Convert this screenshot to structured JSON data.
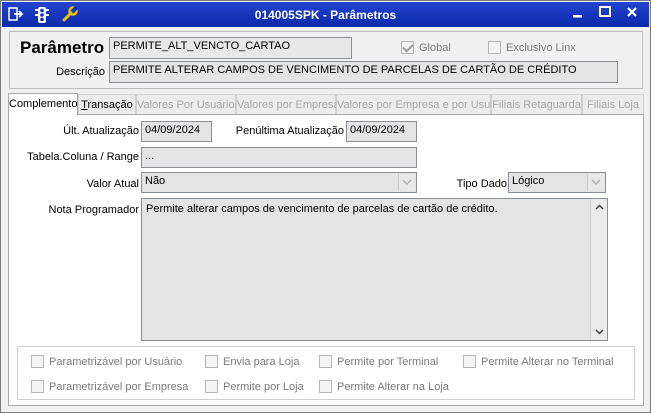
{
  "window": {
    "title": "014005SPK - Parâmetros"
  },
  "header": {
    "param_label": "Parâmetro",
    "param_value": "PERMITE_ALT_VENCTO_CARTAO",
    "desc_label": "Descrição",
    "desc_value": "PERMITE ALTERAR CAMPOS DE VENCIMENTO DE PARCELAS DE CARTÃO DE CRÉDITO",
    "global_label": "Global",
    "global_checked": true,
    "exclusivo_label": "Exclusivo Linx",
    "exclusivo_checked": false
  },
  "tabs": [
    {
      "label": "Complemento",
      "state": "active"
    },
    {
      "label": "Transação",
      "state": "enabled"
    },
    {
      "label": "Valores Por Usuários",
      "state": "disabled"
    },
    {
      "label": "Valores por Empresa",
      "state": "disabled"
    },
    {
      "label": "Valores por Empresa e por Usuário",
      "state": "disabled"
    },
    {
      "label": "Filiais Retaguarda",
      "state": "disabled"
    },
    {
      "label": "Filiais Loja",
      "state": "disabled"
    }
  ],
  "form": {
    "ult_atualizacao_label": "Últ. Atualização",
    "ult_atualizacao_value": "04/09/2024",
    "penultima_label": "Penúltima Atualização",
    "penultima_value": "04/09/2024",
    "tabela_label": "Tabela.Coluna / Range",
    "tabela_value": "...",
    "valor_atual_label": "Valor Atual",
    "valor_atual_value": "Não",
    "tipo_dado_label": "Tipo Dado",
    "tipo_dado_value": "Lógico",
    "nota_label": "Nota Programador",
    "nota_value": "Permite alterar campos de vencimento de parcelas de cartão de crédito."
  },
  "options": [
    {
      "label": "Parametrizável por Usuário",
      "checked": false
    },
    {
      "label": "Envia para Loja",
      "checked": false
    },
    {
      "label": "Permite por Terminal",
      "checked": false
    },
    {
      "label": "Permite Alterar no Terminal",
      "checked": false
    },
    {
      "label": "Parametrizável por Empresa",
      "checked": false
    },
    {
      "label": "Permite por Loja",
      "checked": false
    },
    {
      "label": "Permite Alterar na Loja",
      "checked": false
    }
  ],
  "colors": {
    "titlebar": "#0c2fb8",
    "field_bg": "#e4e4e4",
    "disabled_text": "#a8a8a8"
  },
  "icons": [
    "exit-icon",
    "traffic-light-icon",
    "wrench-icon",
    "minimize-icon",
    "maximize-icon",
    "close-icon"
  ]
}
